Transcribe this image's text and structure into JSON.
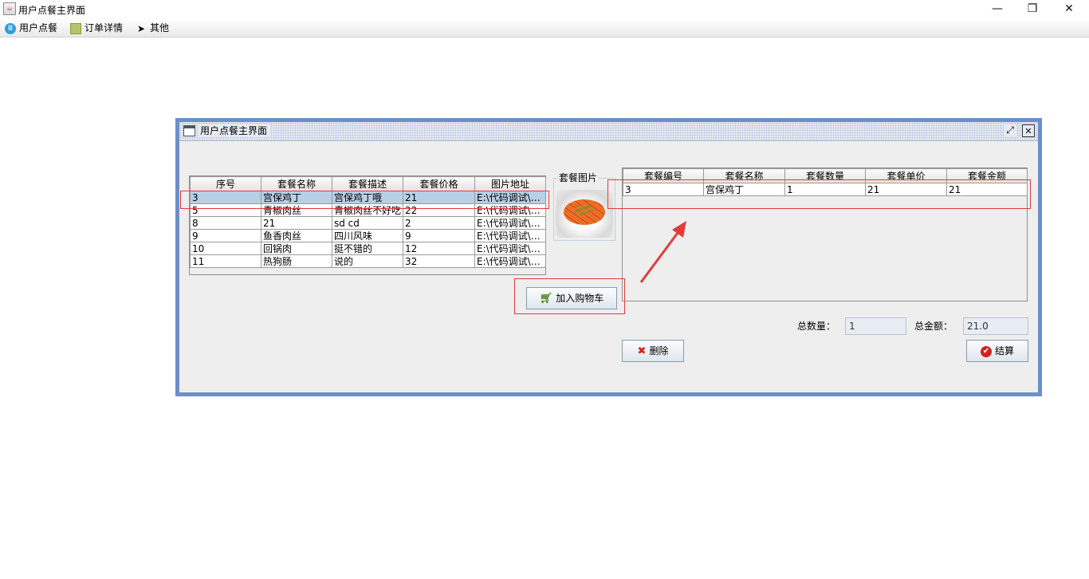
{
  "window": {
    "title": "用户点餐主界面",
    "app_icon": "java-icon"
  },
  "menubar": [
    {
      "label": "用户点餐",
      "icon": "food-icon"
    },
    {
      "label": "订单详情",
      "icon": "calculator-icon"
    },
    {
      "label": "其他",
      "icon": "cursor-icon"
    }
  ],
  "inner_frame": {
    "title": "用户点餐主界面"
  },
  "menu_table": {
    "headers": [
      "序号",
      "套餐名称",
      "套餐描述",
      "套餐价格",
      "图片地址"
    ],
    "rows": [
      [
        "3",
        "宫保鸡丁",
        "宫保鸡丁哦",
        "21",
        "E:\\代码调试\\订..."
      ],
      [
        "5",
        "青椒肉丝",
        "青椒肉丝不好吃",
        "22",
        "E:\\代码调试\\订..."
      ],
      [
        "8",
        "21",
        "sd cd",
        "2",
        "E:\\代码调试\\订..."
      ],
      [
        "9",
        "鱼香肉丝",
        "四川风味",
        "9",
        "E:\\代码调试\\订..."
      ],
      [
        "10",
        "回锅肉",
        "挺不错的",
        "12",
        "E:\\代码调试\\订..."
      ],
      [
        "11",
        "热狗肠",
        "说的",
        "32",
        "E:\\代码调试\\订..."
      ]
    ],
    "selected_row": 0
  },
  "image_panel": {
    "caption": "套餐图片"
  },
  "add_cart_button": {
    "label": "加入购物车",
    "icon": "cart-icon"
  },
  "cart_table": {
    "headers": [
      "套餐编号",
      "套餐名称",
      "套餐数量",
      "套餐单价",
      "套餐金额"
    ],
    "rows": [
      [
        "3",
        "宫保鸡丁",
        "1",
        "21",
        "21"
      ]
    ]
  },
  "summary": {
    "total_qty_label": "总数量：",
    "total_qty_value": "1",
    "total_amount_label": "总金额：",
    "total_amount_value": "21.0"
  },
  "delete_button": {
    "label": "删除",
    "icon": "x-icon"
  },
  "checkout_button": {
    "label": "结算",
    "icon": "check-icon"
  },
  "colors": {
    "annotation": "#e03c3c",
    "frame_border": "#6d8fc9",
    "selection": "#b8cfe5"
  }
}
